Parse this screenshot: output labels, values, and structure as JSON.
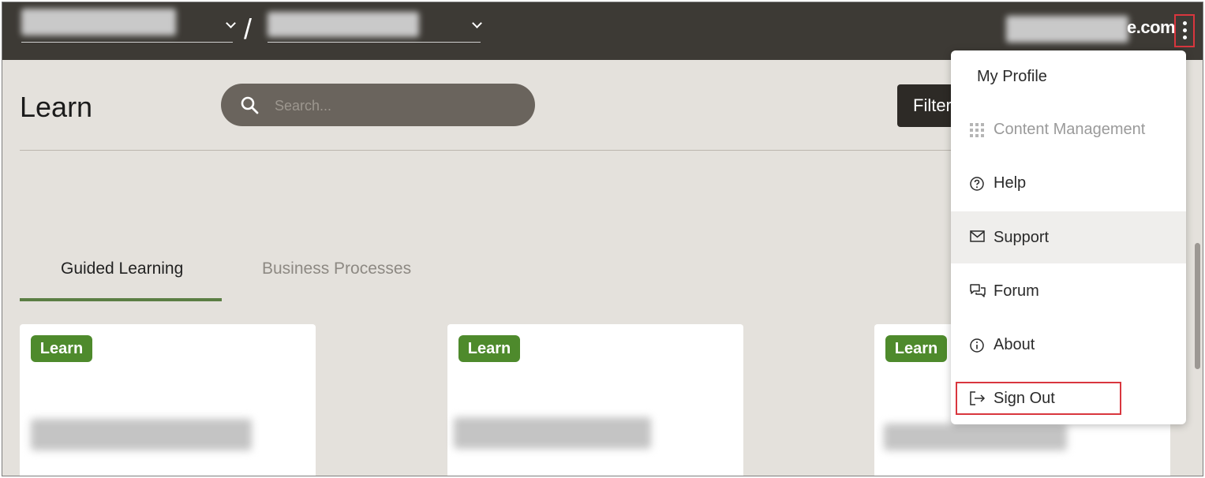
{
  "header": {
    "breadcrumb_separator": "/",
    "user_domain_suffix": "e.com",
    "more_menu_icon": "kebab-vertical-icon"
  },
  "page": {
    "title": "Learn",
    "filter_label": "Filter"
  },
  "search": {
    "placeholder": "Search..."
  },
  "tabs": [
    {
      "label": "Guided Learning",
      "active": true
    },
    {
      "label": "Business Processes",
      "active": false
    }
  ],
  "cards": [
    {
      "badge": "Learn"
    },
    {
      "badge": "Learn"
    },
    {
      "badge": "Learn"
    }
  ],
  "user_menu": {
    "items": [
      {
        "label": "My Profile",
        "icon": "",
        "enabled": true
      },
      {
        "label": "Content Management",
        "icon": "grid-icon",
        "enabled": false
      },
      {
        "label": "Help",
        "icon": "question-circle-icon",
        "enabled": true
      },
      {
        "label": "Support",
        "icon": "envelope-icon",
        "enabled": true,
        "hovered": true
      },
      {
        "label": "Forum",
        "icon": "chat-bubbles-icon",
        "enabled": true
      },
      {
        "label": "About",
        "icon": "info-circle-icon",
        "enabled": true
      },
      {
        "label": "Sign Out",
        "icon": "sign-out-icon",
        "enabled": true,
        "highlighted": true
      }
    ]
  },
  "colors": {
    "topbar": "#3d3a35",
    "page_background": "#e4e1dc",
    "badge_green": "#4e8a2c",
    "tab_underline": "#5b7e44",
    "highlight_red": "#d9363e"
  }
}
